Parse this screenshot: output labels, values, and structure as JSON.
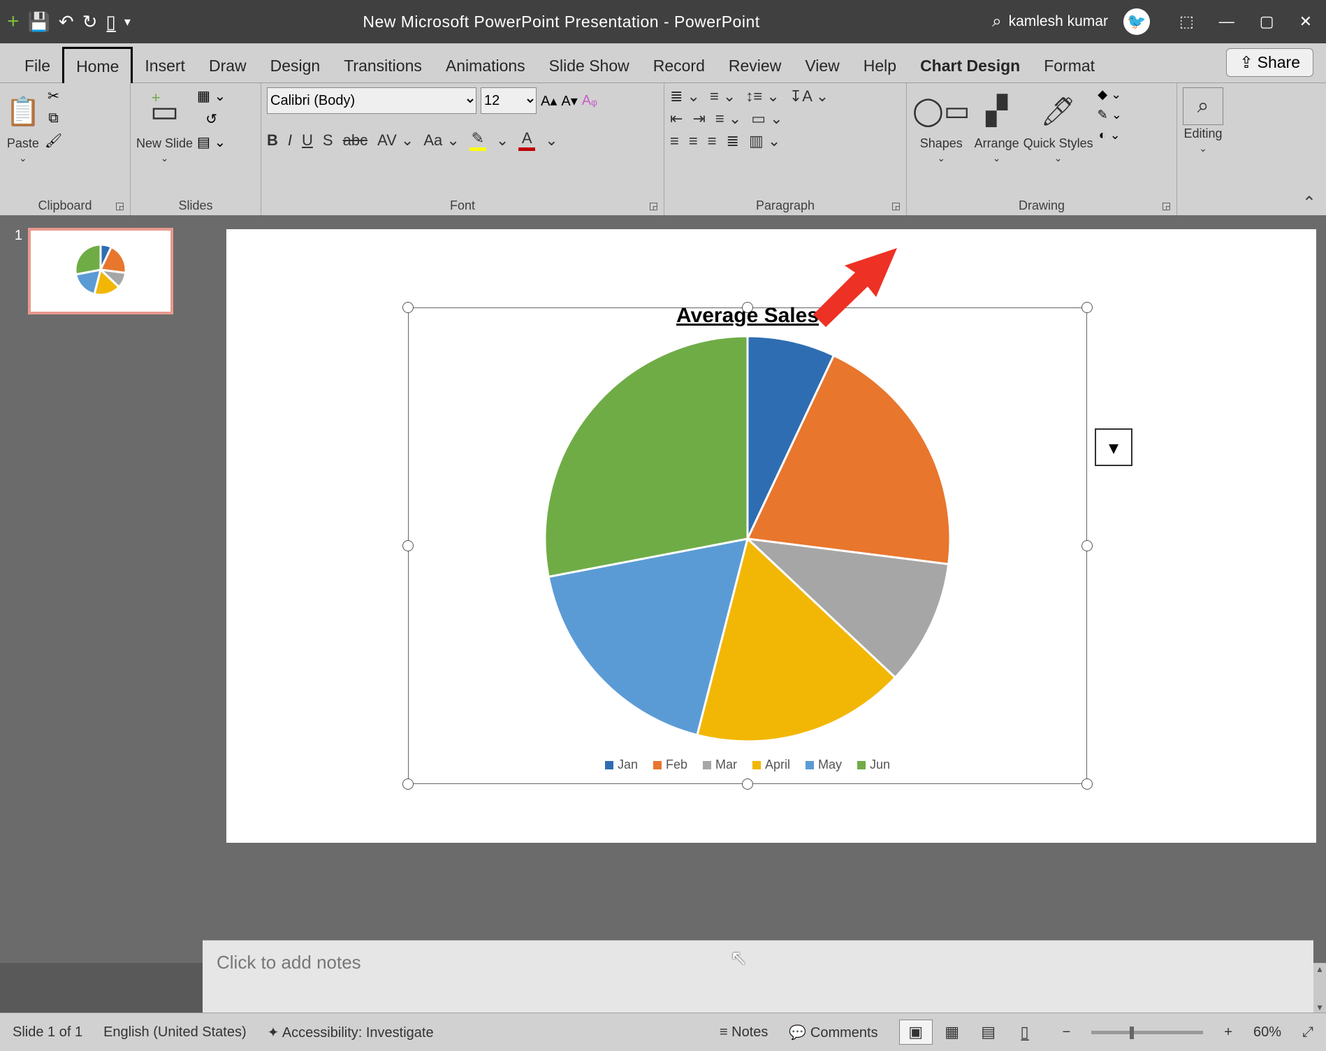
{
  "title": "New Microsoft PowerPoint Presentation  -  PowerPoint",
  "user": "kamlesh kumar",
  "qat": {
    "save": "💾",
    "undo": "↶",
    "redo": "↻",
    "start": "▯̲"
  },
  "win": {
    "collapse": "⬚",
    "min": "—",
    "max": "▢",
    "close": "✕"
  },
  "tabs": [
    "File",
    "Home",
    "Insert",
    "Draw",
    "Design",
    "Transitions",
    "Animations",
    "Slide Show",
    "Record",
    "Review",
    "View",
    "Help",
    "Chart Design",
    "Format"
  ],
  "active_tab": "Home",
  "share": "Share",
  "ribbon": {
    "clipboard": {
      "label": "Clipboard",
      "paste": "Paste"
    },
    "slides": {
      "label": "Slides",
      "new": "New Slide"
    },
    "font": {
      "label": "Font",
      "name": "Calibri (Body)",
      "size": "12",
      "inc": "A▴",
      "dec": "A▾",
      "clear": "Aᵩ",
      "b": "B",
      "i": "I",
      "u": "U",
      "s": "S",
      "strike": "abc",
      "av": "AV",
      "aa": "Aa",
      "hl_color": "#ffff00",
      "fc_color": "#c00000"
    },
    "para": {
      "label": "Paragraph"
    },
    "drawing": {
      "label": "Drawing",
      "shapes": "Shapes",
      "arrange": "Arrange",
      "quick": "Quick Styles"
    },
    "editing": {
      "label": "Editing",
      "edit": "Editing"
    }
  },
  "thumb_num": "1",
  "notes_placeholder": "Click to add notes",
  "status": {
    "slide": "Slide 1 of 1",
    "lang": "English (United States)",
    "acc": "Accessibility: Investigate",
    "notes": "Notes",
    "comments": "Comments",
    "zoom": "60%"
  },
  "chart_data": {
    "type": "pie",
    "title": "Average Sales",
    "series": [
      {
        "name": "Jan",
        "value": 7,
        "color": "#2f6db2"
      },
      {
        "name": "Feb",
        "value": 20,
        "color": "#e8762d"
      },
      {
        "name": "Mar",
        "value": 10,
        "color": "#a6a6a6"
      },
      {
        "name": "April",
        "value": 17,
        "color": "#f2b705"
      },
      {
        "name": "May",
        "value": 18,
        "color": "#5b9bd5"
      },
      {
        "name": "Jun",
        "value": 28,
        "color": "#6fac46"
      }
    ]
  }
}
